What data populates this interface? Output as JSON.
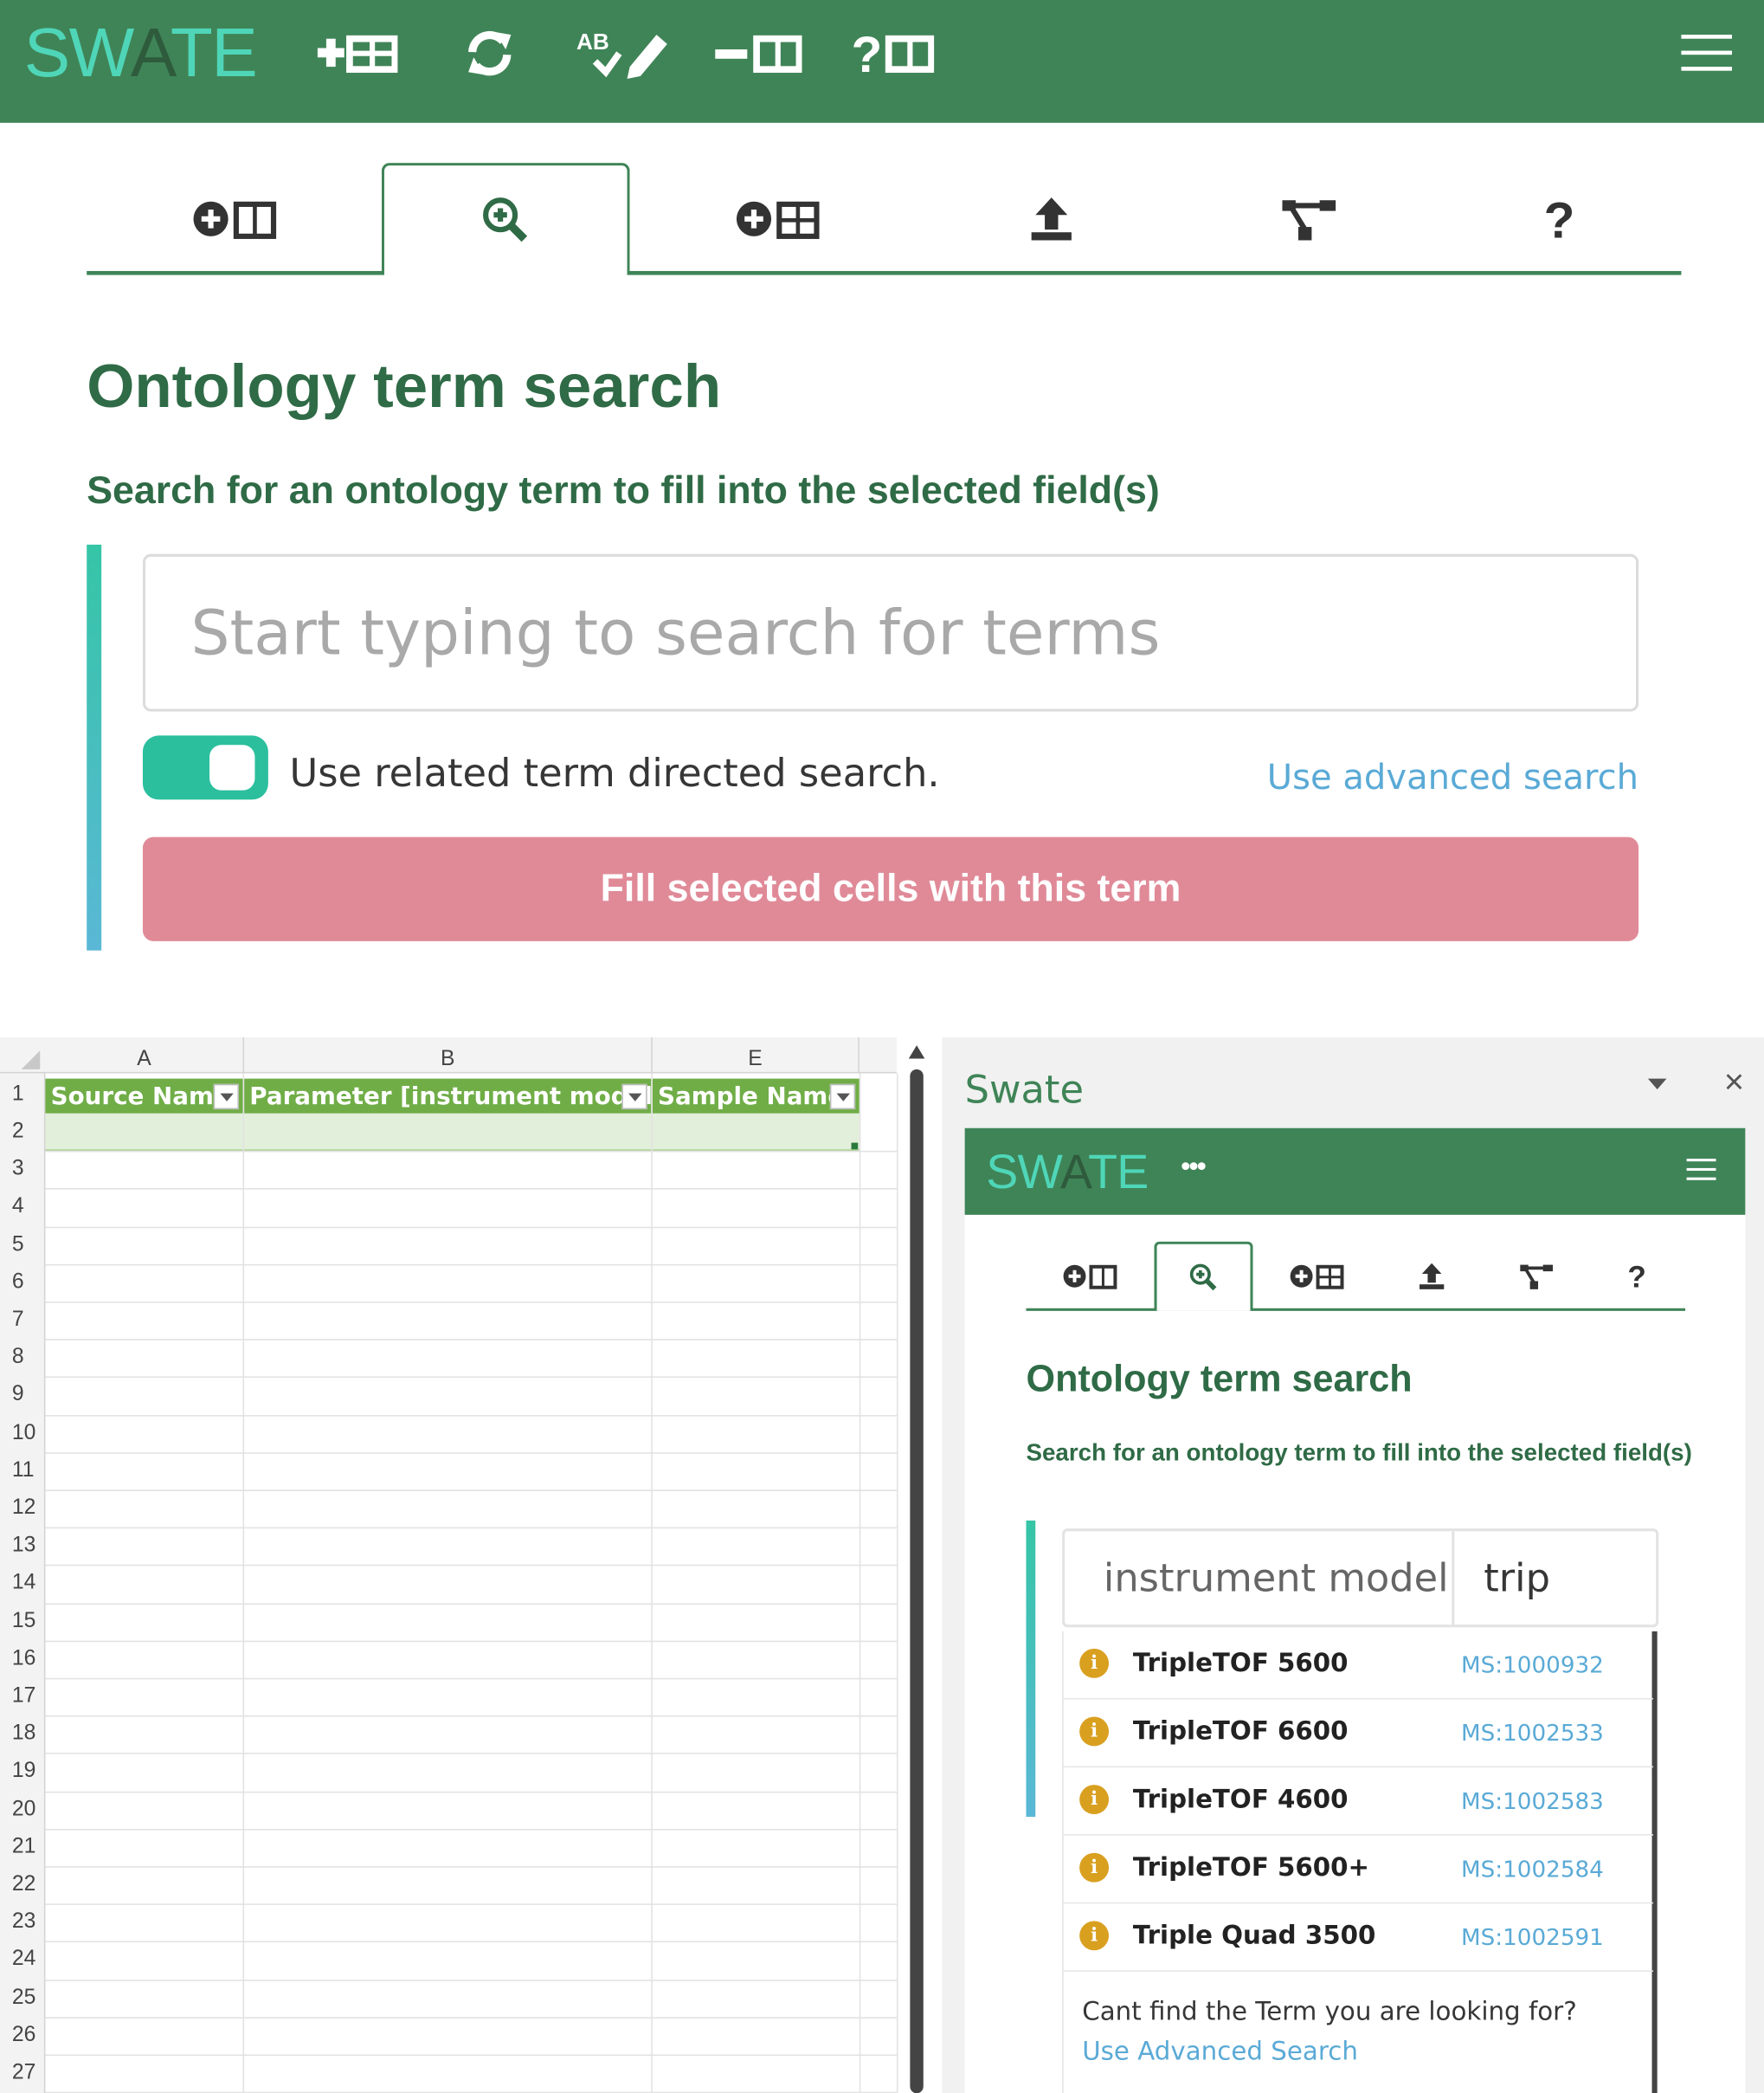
{
  "app": {
    "logo": {
      "part1": "SW",
      "part2": "A",
      "part3": "TE"
    },
    "nav_icons": [
      "add-table-icon",
      "refresh-icon",
      "spellcheck-icon",
      "remove-column-icon",
      "help-column-icon"
    ],
    "hamburger_icon": "hamburger-menu-icon",
    "tabs": [
      {
        "icon": "add-building-block-icon",
        "active": false
      },
      {
        "icon": "term-search-icon",
        "active": true
      },
      {
        "icon": "add-template-icon",
        "active": false
      },
      {
        "icon": "upload-icon",
        "active": false
      },
      {
        "icon": "protocol-tree-icon",
        "active": false
      },
      {
        "icon": "help-icon",
        "active": false
      }
    ],
    "title": "Ontology term search",
    "subtitle": "Search for an ontology term to fill into the selected field(s)",
    "search_placeholder": "Start typing to search for terms",
    "toggle_label": "Use related term directed search.",
    "toggle_on": true,
    "advanced_link": "Use advanced search",
    "fill_button": "Fill selected cells with this term"
  },
  "sheet": {
    "column_letters": [
      "A",
      "B",
      "E"
    ],
    "headers": [
      "Source Name",
      "Parameter [instrument model]",
      "Sample Name"
    ],
    "row_numbers": [
      "1",
      "2",
      "3",
      "4",
      "5",
      "6",
      "7",
      "8",
      "9",
      "10",
      "11",
      "12",
      "13",
      "14",
      "15",
      "16",
      "17",
      "18",
      "19",
      "20",
      "21",
      "22",
      "23",
      "24",
      "25",
      "26",
      "27"
    ]
  },
  "pane": {
    "title": "Swate",
    "close": "×",
    "dots": "•••",
    "search_parent": "instrument model",
    "search_value": "trip",
    "results": [
      {
        "name": "TripleTOF 5600",
        "id": "MS:1000932"
      },
      {
        "name": "TripleTOF 6600",
        "id": "MS:1002533"
      },
      {
        "name": "TripleTOF 4600",
        "id": "MS:1002583"
      },
      {
        "name": "TripleTOF 5600+",
        "id": "MS:1002584"
      },
      {
        "name": "Triple Quad 3500",
        "id": "MS:1002591"
      }
    ],
    "info_glyph": "i",
    "footer_text": "Cant find the Term you are looking for? ",
    "footer_link": "Use Advanced Search"
  },
  "colors": {
    "brand_green": "#3f8457",
    "accent_teal": "#2bbf9e",
    "table_header": "#70ad47",
    "fill_button": "#e08a98",
    "link": "#5aaad6"
  }
}
